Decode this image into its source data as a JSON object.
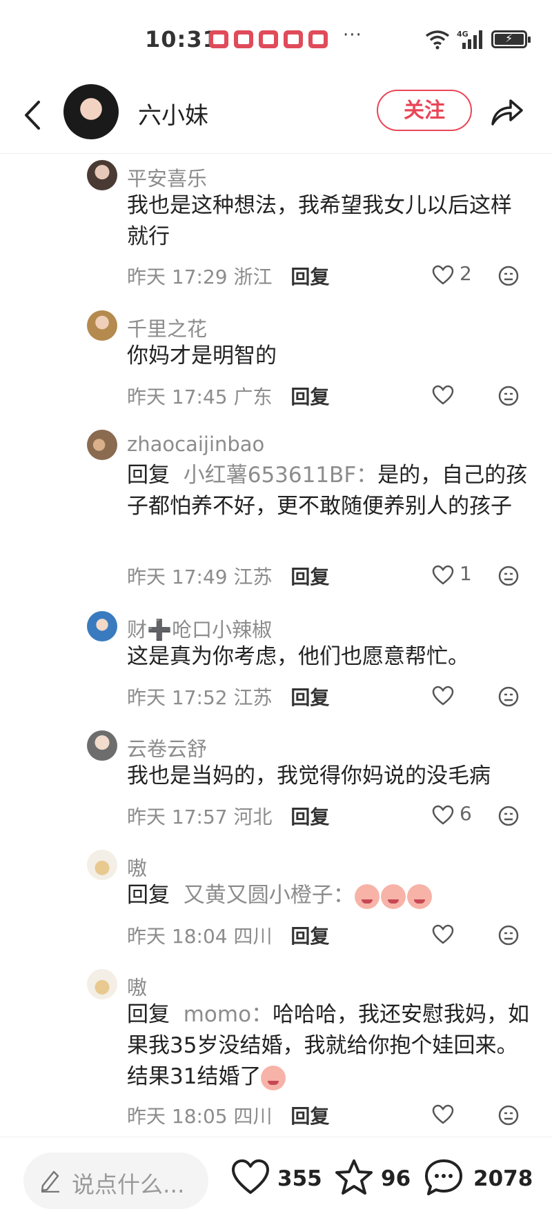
{
  "status_bar": {
    "time": "10:31",
    "more": "···",
    "network": "4G"
  },
  "header": {
    "author_name": "六小妹",
    "follow_label": "关注"
  },
  "comments": [
    {
      "user": "平安喜乐",
      "text": "我也是这种想法，我希望我女儿以后这样就行",
      "time": "昨天 17:29",
      "location": "浙江",
      "reply_label": "回复",
      "likes": "2"
    },
    {
      "user": "千里之花",
      "text": "你妈才是明智的",
      "time": "昨天 17:45",
      "location": "广东",
      "reply_label": "回复",
      "likes": ""
    },
    {
      "user": "zhaocaijinbao",
      "reply_prefix": "回复",
      "reply_target": "小红薯653611BF：",
      "text": "是的，自己的孩子都怕养不好，更不敢随便养别人的孩子",
      "time": "昨天 17:49",
      "location": "江苏",
      "reply_label": "回复",
      "likes": "1"
    },
    {
      "user": "财➕呛口小辣椒",
      "text": "这是真为你考虑，他们也愿意帮忙。",
      "time": "昨天 17:52",
      "location": "江苏",
      "reply_label": "回复",
      "likes": ""
    },
    {
      "user": "云卷云舒",
      "text": "我也是当妈的，我觉得你妈说的没毛病",
      "time": "昨天 17:57",
      "location": "河北",
      "reply_label": "回复",
      "likes": "6"
    },
    {
      "user": "嗷",
      "reply_prefix": "回复",
      "reply_target": "又黄又圆小橙子：",
      "text": "",
      "time": "昨天 18:04",
      "location": "四川",
      "reply_label": "回复",
      "likes": ""
    },
    {
      "user": "嗷",
      "reply_prefix": "回复",
      "reply_target": "momo：",
      "text": "哈哈哈，我还安慰我妈，如果我35岁没结婚，我就给你抱个娃回来。结果31结婚了",
      "time": "昨天 18:05",
      "location": "四川",
      "reply_label": "回复",
      "likes": ""
    }
  ],
  "bottom_bar": {
    "placeholder": "说点什么...",
    "like_count": "355",
    "collect_count": "96",
    "comment_count": "2078"
  },
  "colors": {
    "accent": "#ea4557",
    "muted": "#8c8c8c"
  }
}
